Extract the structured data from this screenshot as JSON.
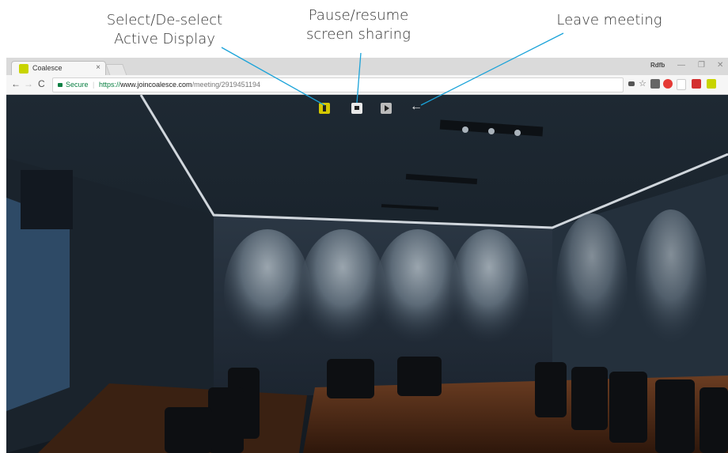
{
  "annotations": {
    "select_display": [
      "Select/De-select",
      "Active Display"
    ],
    "pause_sharing": [
      "Pause/resume",
      "screen sharing"
    ],
    "leave_meeting": "Leave meeting"
  },
  "browser": {
    "tab_title": "Coalesce",
    "tab_close": "×",
    "user_badge": "Rdfb",
    "controls": {
      "back": "←",
      "forward": "→",
      "reload": "C",
      "minimize": "—",
      "restore": "❐",
      "close": "✕"
    },
    "address": {
      "secure_label": "Secure",
      "scheme": "https://",
      "host": "www.joincoalesce.com",
      "path": "/meeting/2919451194"
    },
    "extensions": [
      "camera-icon",
      "star-icon",
      "square-icon",
      "abp-icon",
      "page-icon",
      "red-extension-icon",
      "coalesce-extension-icon"
    ]
  },
  "meeting_toolbar": {
    "buttons": [
      "select-display-icon",
      "pause-sharing-icon",
      "media-icon",
      "leave-arrow-icon"
    ],
    "leave_glyph": "←",
    "accent": "#d4c800"
  }
}
